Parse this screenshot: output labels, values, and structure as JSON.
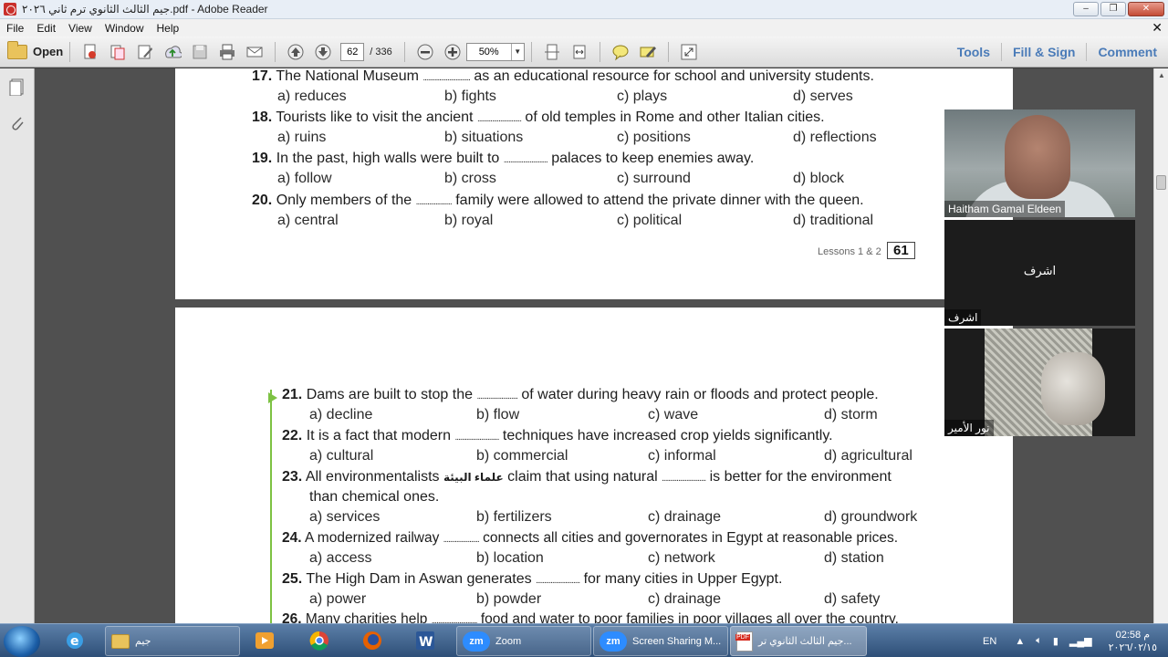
{
  "window": {
    "title": "جيم الثالث الثانوي ترم ثاني ٢٠٢٦.pdf - Adobe Reader"
  },
  "menu": [
    "File",
    "Edit",
    "View",
    "Window",
    "Help"
  ],
  "toolbar": {
    "open_label": "Open",
    "page_current": "62",
    "page_total": "/ 336",
    "zoom": "50%",
    "right": [
      "Tools",
      "Fill & Sign",
      "Comment"
    ]
  },
  "page1": {
    "questions": [
      {
        "num": "17.",
        "before": "The National Museum",
        "after": "as an educational resource for school and university students.",
        "options": [
          "a) reduces",
          "b) fights",
          "c) plays",
          "d) serves"
        ]
      },
      {
        "num": "18.",
        "before": "Tourists like to visit the ancient",
        "after": "of old temples in Rome and other Italian cities.",
        "options": [
          "a) ruins",
          "b) situations",
          "c) positions",
          "d) reflections"
        ]
      },
      {
        "num": "19.",
        "before": "In the past, high walls were built to",
        "after": "palaces to keep enemies away.",
        "options": [
          "a) follow",
          "b) cross",
          "c) surround",
          "d) block"
        ]
      },
      {
        "num": "20.",
        "before": "Only members of the",
        "after": "family were allowed to attend the private dinner with the queen.",
        "options": [
          "a) central",
          "b) royal",
          "c) political",
          "d) traditional"
        ]
      }
    ],
    "footer": "Lessons 1 & 2",
    "page_number": "61"
  },
  "page2": {
    "questions": [
      {
        "num": "21.",
        "before": "Dams are built to stop the",
        "after": "of water during heavy rain or floods and protect people.",
        "options": [
          "a) decline",
          "b) flow",
          "c) wave",
          "d) storm"
        ]
      },
      {
        "num": "22.",
        "before": "It is a fact that modern",
        "after": "techniques have increased crop yields significantly.",
        "options": [
          "a) cultural",
          "b) commercial",
          "c) informal",
          "d) agricultural"
        ]
      },
      {
        "num": "23.",
        "before": "All environmentalists",
        "arabic": "علماء البيئة",
        "mid": "claim that using natural",
        "after": "is better for the environment",
        "line2": "than chemical ones.",
        "options": [
          "a) services",
          "b) fertilizers",
          "c) drainage",
          "d) groundwork"
        ]
      },
      {
        "num": "24.",
        "before": "A modernized railway",
        "after": "connects all cities and governorates in Egypt at reasonable prices.",
        "options": [
          "a) access",
          "b) location",
          "c) network",
          "d) station"
        ]
      },
      {
        "num": "25.",
        "before": "The High Dam in Aswan generates",
        "after": "for many cities in Upper Egypt.",
        "options": [
          "a) power",
          "b) powder",
          "c) drainage",
          "d) safety"
        ]
      },
      {
        "num": "26.",
        "before": "Many charities help",
        "after": "food and water to poor families in poor villages all over the country.",
        "options": []
      }
    ]
  },
  "participants": [
    {
      "name": "Haitham Gamal Eldeen"
    },
    {
      "name": "اشرف",
      "center": "اشرف"
    },
    {
      "name": "نور الأمير"
    }
  ],
  "taskbar": {
    "items": [
      {
        "label": "جيم"
      },
      {
        "label": "Zoom"
      },
      {
        "label": "Screen Sharing M..."
      },
      {
        "label": "جيم الثالث الثانوي تر..."
      }
    ],
    "lang": "EN",
    "time": "02:58 م",
    "date": "٢٠٢٦/٠٢/١٥"
  }
}
